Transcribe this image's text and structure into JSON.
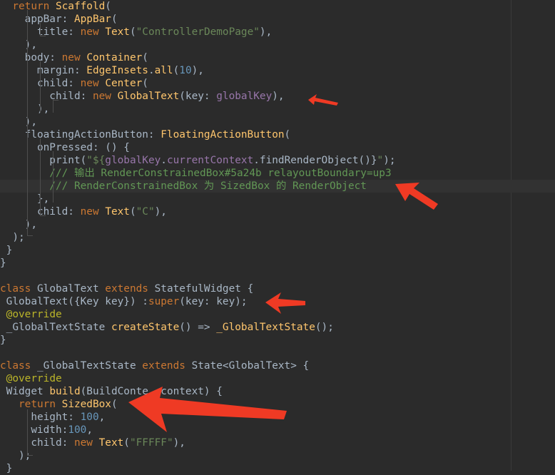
{
  "colors": {
    "background": "#2b2b2b",
    "keyword": "#cc7832",
    "type": "#ffc66d",
    "string": "#6a8759",
    "number": "#6897bb",
    "comment": "#629755",
    "annotation": "#bbb529",
    "field": "#9876aa",
    "plain": "#a9b7c6",
    "arrow": "#ef3a24"
  },
  "code_lines": [
    [
      {
        "t": "  ",
        "c": "plain"
      },
      {
        "t": "return",
        "c": "keyword"
      },
      {
        "t": " ",
        "c": "plain"
      },
      {
        "t": "Scaffold",
        "c": "type"
      },
      {
        "t": "(",
        "c": "plain"
      }
    ],
    [
      {
        "t": "    appBar: ",
        "c": "plain"
      },
      {
        "t": "AppBar",
        "c": "type"
      },
      {
        "t": "(",
        "c": "plain"
      }
    ],
    [
      {
        "t": "      title: ",
        "c": "plain"
      },
      {
        "t": "new",
        "c": "keyword"
      },
      {
        "t": " ",
        "c": "plain"
      },
      {
        "t": "Text",
        "c": "type"
      },
      {
        "t": "(",
        "c": "plain"
      },
      {
        "t": "\"ControllerDemoPage\"",
        "c": "string"
      },
      {
        "t": "),",
        "c": "plain"
      }
    ],
    [
      {
        "t": "    ),",
        "c": "plain"
      }
    ],
    [
      {
        "t": "    body: ",
        "c": "plain"
      },
      {
        "t": "new",
        "c": "keyword"
      },
      {
        "t": " ",
        "c": "plain"
      },
      {
        "t": "Container",
        "c": "type"
      },
      {
        "t": "(",
        "c": "plain"
      }
    ],
    [
      {
        "t": "      margin: ",
        "c": "plain"
      },
      {
        "t": "EdgeInsets",
        "c": "type"
      },
      {
        "t": ".",
        "c": "plain"
      },
      {
        "t": "all",
        "c": "type"
      },
      {
        "t": "(",
        "c": "plain"
      },
      {
        "t": "10",
        "c": "number"
      },
      {
        "t": "),",
        "c": "plain"
      }
    ],
    [
      {
        "t": "      child: ",
        "c": "plain"
      },
      {
        "t": "new",
        "c": "keyword"
      },
      {
        "t": " ",
        "c": "plain"
      },
      {
        "t": "Center",
        "c": "type"
      },
      {
        "t": "(",
        "c": "plain"
      }
    ],
    [
      {
        "t": "        child: ",
        "c": "plain"
      },
      {
        "t": "new",
        "c": "keyword"
      },
      {
        "t": " ",
        "c": "plain"
      },
      {
        "t": "GlobalText",
        "c": "type"
      },
      {
        "t": "(key: ",
        "c": "plain"
      },
      {
        "t": "globalKey",
        "c": "field"
      },
      {
        "t": "),",
        "c": "plain"
      }
    ],
    [
      {
        "t": "      ),",
        "c": "plain"
      }
    ],
    [
      {
        "t": "    ),",
        "c": "plain"
      }
    ],
    [
      {
        "t": "    floatingActionButton: ",
        "c": "plain"
      },
      {
        "t": "FloatingActionButton",
        "c": "type"
      },
      {
        "t": "(",
        "c": "plain"
      }
    ],
    [
      {
        "t": "      onPressed: () {",
        "c": "plain"
      }
    ],
    [
      {
        "t": "        print(",
        "c": "plain"
      },
      {
        "t": "\"${",
        "c": "string"
      },
      {
        "t": "globalKey",
        "c": "field"
      },
      {
        "t": ".",
        "c": "plain"
      },
      {
        "t": "currentContext",
        "c": "field"
      },
      {
        "t": ".findRenderObject()}",
        "c": "plain"
      },
      {
        "t": "\"",
        "c": "string"
      },
      {
        "t": ");",
        "c": "plain"
      }
    ],
    [
      {
        "t": "        /// 输出 RenderConstrainedBox#5a24b relayoutBoundary=up3",
        "c": "comment"
      }
    ],
    [
      {
        "t": "        /// RenderConstrainedBox 为 SizedBox 的 RenderObject",
        "c": "comment"
      }
    ],
    [
      {
        "t": "      },",
        "c": "plain"
      }
    ],
    [
      {
        "t": "      child: ",
        "c": "plain"
      },
      {
        "t": "new",
        "c": "keyword"
      },
      {
        "t": " ",
        "c": "plain"
      },
      {
        "t": "Text",
        "c": "type"
      },
      {
        "t": "(",
        "c": "plain"
      },
      {
        "t": "\"C\"",
        "c": "string"
      },
      {
        "t": "),",
        "c": "plain"
      }
    ],
    [
      {
        "t": "    ),",
        "c": "plain"
      }
    ],
    [
      {
        "t": "  );",
        "c": "plain"
      }
    ],
    [
      {
        "t": " }",
        "c": "plain"
      }
    ],
    [
      {
        "t": "}",
        "c": "plain"
      }
    ],
    [
      {
        "t": "",
        "c": "plain"
      }
    ],
    [
      {
        "t": "class",
        "c": "keyword"
      },
      {
        "t": " GlobalText ",
        "c": "plain"
      },
      {
        "t": "extends",
        "c": "keyword"
      },
      {
        "t": " StatefulWidget {",
        "c": "plain"
      }
    ],
    [
      {
        "t": " GlobalText({Key key}) :",
        "c": "plain"
      },
      {
        "t": "super",
        "c": "keyword"
      },
      {
        "t": "(key: key);",
        "c": "plain"
      }
    ],
    [
      {
        "t": " ",
        "c": "plain"
      },
      {
        "t": "@override",
        "c": "annotation"
      }
    ],
    [
      {
        "t": " _GlobalTextState ",
        "c": "plain"
      },
      {
        "t": "createState",
        "c": "type"
      },
      {
        "t": "() => ",
        "c": "plain"
      },
      {
        "t": "_GlobalTextState",
        "c": "type"
      },
      {
        "t": "();",
        "c": "plain"
      }
    ],
    [
      {
        "t": "}",
        "c": "plain"
      }
    ],
    [
      {
        "t": "",
        "c": "plain"
      }
    ],
    [
      {
        "t": "class",
        "c": "keyword"
      },
      {
        "t": " _GlobalTextState ",
        "c": "plain"
      },
      {
        "t": "extends",
        "c": "keyword"
      },
      {
        "t": " State<GlobalText> {",
        "c": "plain"
      }
    ],
    [
      {
        "t": " ",
        "c": "plain"
      },
      {
        "t": "@override",
        "c": "annotation"
      }
    ],
    [
      {
        "t": " Widget ",
        "c": "plain"
      },
      {
        "t": "build",
        "c": "type"
      },
      {
        "t": "(BuildConte",
        "c": "plain"
      },
      {
        "t": "  ",
        "c": "plain"
      },
      {
        "t": "context) {",
        "c": "plain"
      }
    ],
    [
      {
        "t": "   ",
        "c": "plain"
      },
      {
        "t": "return",
        "c": "keyword"
      },
      {
        "t": " ",
        "c": "plain"
      },
      {
        "t": "SizedBox",
        "c": "type"
      },
      {
        "t": "(",
        "c": "plain"
      }
    ],
    [
      {
        "t": "     height: ",
        "c": "plain"
      },
      {
        "t": "100",
        "c": "number"
      },
      {
        "t": ",",
        "c": "plain"
      }
    ],
    [
      {
        "t": "     width:",
        "c": "plain"
      },
      {
        "t": "100",
        "c": "number"
      },
      {
        "t": ",",
        "c": "plain"
      }
    ],
    [
      {
        "t": "     child: ",
        "c": "plain"
      },
      {
        "t": "new",
        "c": "keyword"
      },
      {
        "t": " ",
        "c": "plain"
      },
      {
        "t": "Text",
        "c": "type"
      },
      {
        "t": "(",
        "c": "plain"
      },
      {
        "t": "\"FFFFF\"",
        "c": "string"
      },
      {
        "t": "),",
        "c": "plain"
      }
    ],
    [
      {
        "t": "   );",
        "c": "plain"
      }
    ],
    [
      {
        "t": " }",
        "c": "plain"
      }
    ]
  ],
  "current_line": 14,
  "arrows": [
    {
      "name": "arrow-pointing-globalkey"
    },
    {
      "name": "arrow-pointing-comment"
    },
    {
      "name": "arrow-pointing-super-key"
    },
    {
      "name": "arrow-pointing-sizedbox"
    }
  ]
}
